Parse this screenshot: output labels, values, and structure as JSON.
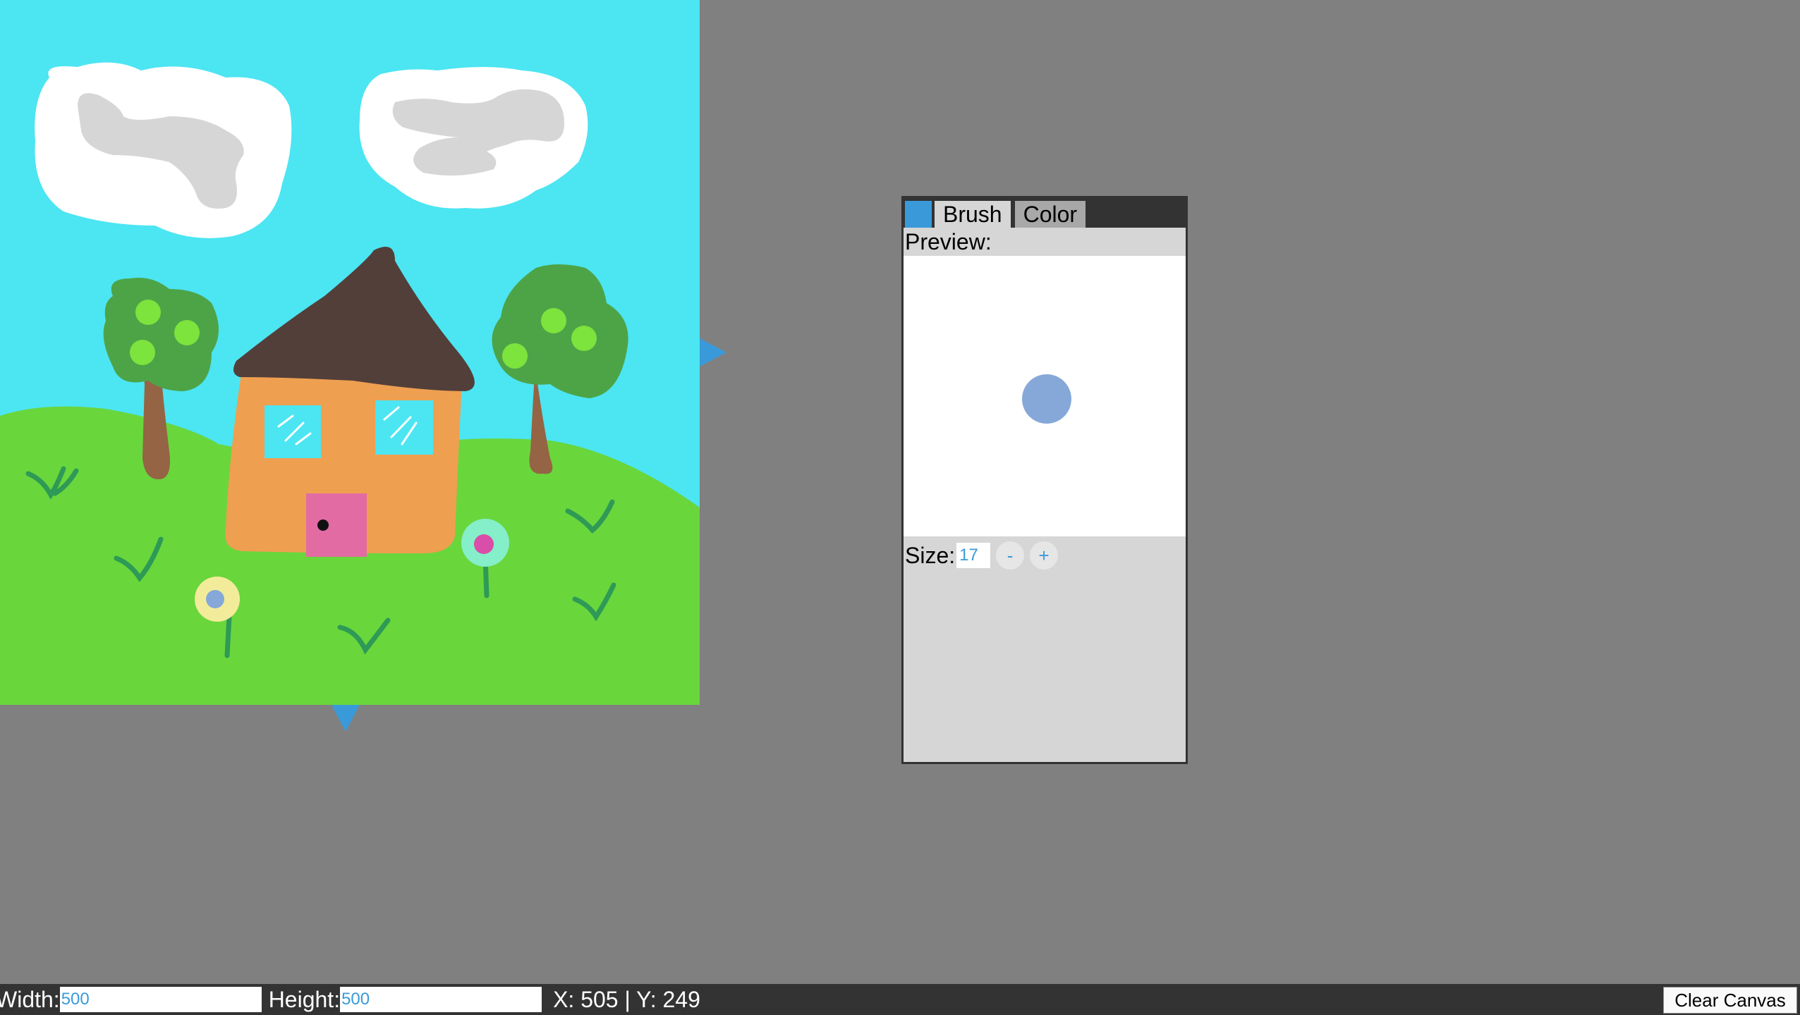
{
  "panel": {
    "tabs": [
      {
        "label": "Brush",
        "active": true
      },
      {
        "label": "Color",
        "active": false
      }
    ],
    "preview_label": "Preview:",
    "size_label": "Size:",
    "size_value": "17",
    "decrement_label": "-",
    "increment_label": "+",
    "brush_color": "#3a9ad9",
    "preview_color": "#86a8d8"
  },
  "bottom_bar": {
    "width_label": "Width:",
    "width_value": "500",
    "height_label": "Height:",
    "height_value": "500",
    "coords": "X: 505 | Y: 249",
    "clear_label": "Clear Canvas"
  },
  "colors": {
    "sky": "#4ce5f2",
    "grass": "#69d63c",
    "roof": "#523f3a",
    "house": "#ef9f50",
    "door": "#e26ba4",
    "tree_canopy": "#4da447",
    "tree_trunk": "#946445",
    "cloud": "#ffffff",
    "cloud_scribble": "#d6d6d6",
    "accent": "#3a9ad9",
    "workspace": "#808080"
  }
}
